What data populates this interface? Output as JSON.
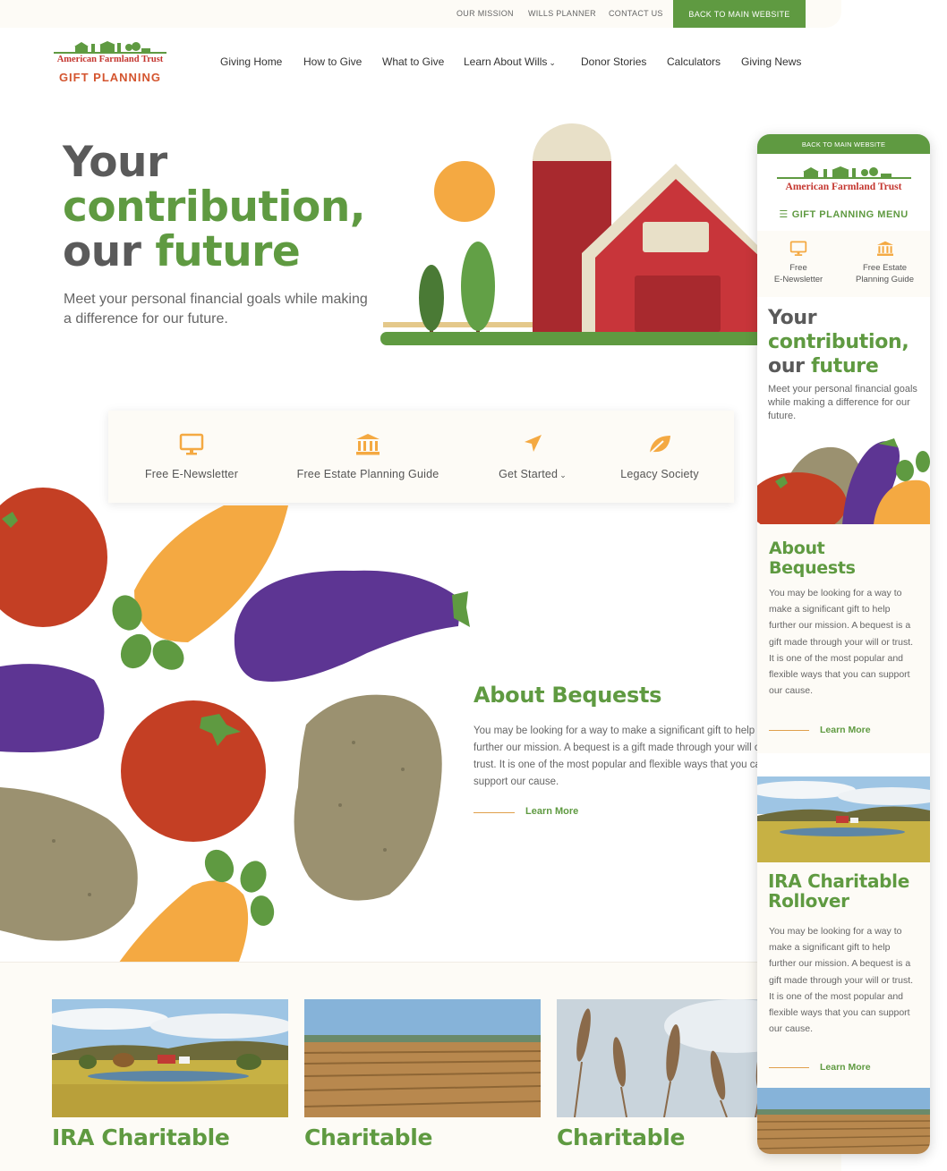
{
  "utility_nav": {
    "links": [
      "OUR MISSION",
      "WILLS PLANNER",
      "CONTACT US"
    ],
    "cta": "BACK TO MAIN WEBSITE"
  },
  "logo": {
    "name": "American Farmland Trust",
    "sub": "GIFT PLANNING"
  },
  "main_nav": [
    "Giving Home",
    "How to Give",
    "What to Give",
    "Learn About Wills",
    "Donor Stories",
    "Calculators",
    "Giving News"
  ],
  "hero": {
    "title_line1": "Your",
    "title_line2": "contribution,",
    "title_line3_a": "our",
    "title_line3_b": "future",
    "subtitle": "Meet your personal financial goals while making a difference for our future."
  },
  "quick_links": [
    {
      "label": "Free E-Newsletter",
      "icon": "monitor-icon"
    },
    {
      "label": "Free Estate Planning Guide",
      "icon": "bank-icon"
    },
    {
      "label": "Get Started",
      "icon": "navigation-arrow-icon"
    },
    {
      "label": "Legacy Society",
      "icon": "leaf-icon"
    }
  ],
  "bequests": {
    "title": "About Bequests",
    "body": "You may be looking for a way to make a significant gift to help further our mission. A bequest is a gift made through your will or trust. It is one of the most popular and flexible ways that you can support our cause.",
    "link": "Learn More"
  },
  "cards": [
    {
      "title": "IRA Charitable"
    },
    {
      "title": "Charitable"
    },
    {
      "title": "Charitable"
    }
  ],
  "mobile": {
    "top_cta": "BACK TO MAIN WEBSITE",
    "logo_name": "American Farmland Trust",
    "menu": "GIFT PLANNING MENU",
    "quick_links": [
      {
        "line1": "Free",
        "line2": "E-Newsletter"
      },
      {
        "line1": "Free Estate",
        "line2": "Planning Guide"
      }
    ],
    "hero_line1": "Your",
    "hero_line2": "contribution,",
    "hero_line3_a": "our",
    "hero_line3_b": "future",
    "hero_sub": "Meet your personal financial goals while making a difference for our future.",
    "bequest_title_1": "About",
    "bequest_title_2": "Bequests",
    "bequest_body": "You may be looking for a way to make a significant gift to help further our mission. A bequest is a gift made through your will or trust. It is one of the most popular and flexible ways that you can support our cause.",
    "bequest_link": "Learn More",
    "ira_title_1": "IRA Charitable",
    "ira_title_2": "Rollover",
    "ira_body": "You may be looking for a way to make a significant gift to help further our mission. A bequest is a gift made through your will or trust. It is one of the most popular and flexible ways that you can support our cause.",
    "ira_link": "Learn More"
  },
  "colors": {
    "brand_green": "#5f9a41",
    "accent_orange": "#f4a942",
    "barn_red": "#c8353a",
    "logo_red": "#c4362f",
    "cream": "#fdfbf6"
  }
}
